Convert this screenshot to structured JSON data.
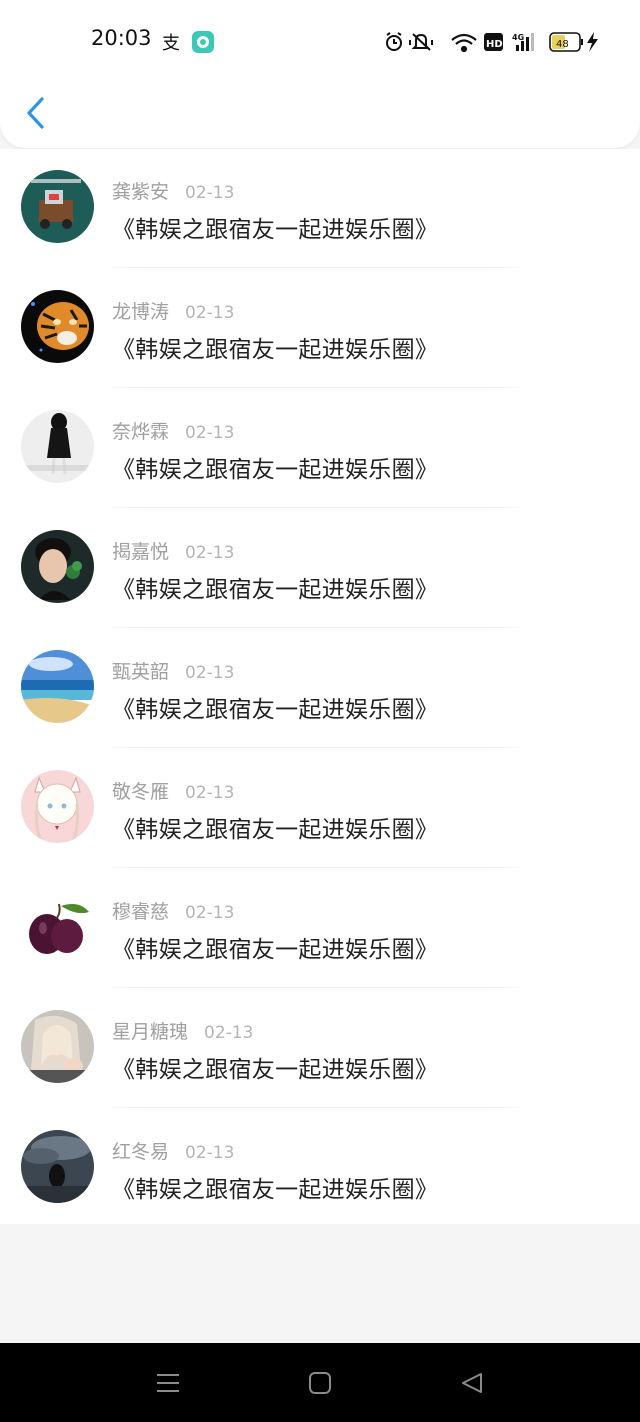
{
  "status_bar": {
    "time": "20:03",
    "battery": "48"
  },
  "header": {
    "back_icon": "chevron-left-icon",
    "accent_color": "#2c96e0"
  },
  "messages": [
    {
      "user": "龚紫安",
      "date": "02-13",
      "text": "《韩娱之跟宿友一起进娱乐圈》"
    },
    {
      "user": "龙博涛",
      "date": "02-13",
      "text": "《韩娱之跟宿友一起进娱乐圈》"
    },
    {
      "user": "奈烨霖",
      "date": "02-13",
      "text": "《韩娱之跟宿友一起进娱乐圈》"
    },
    {
      "user": "揭嘉悦",
      "date": "02-13",
      "text": "《韩娱之跟宿友一起进娱乐圈》"
    },
    {
      "user": "甄英韶",
      "date": "02-13",
      "text": "《韩娱之跟宿友一起进娱乐圈》"
    },
    {
      "user": "敬冬雁",
      "date": "02-13",
      "text": "《韩娱之跟宿友一起进娱乐圈》"
    },
    {
      "user": "穆睿慈",
      "date": "02-13",
      "text": "《韩娱之跟宿友一起进娱乐圈》"
    },
    {
      "user": "星月糖瑰",
      "date": "02-13",
      "text": "《韩娱之跟宿友一起进娱乐圈》"
    },
    {
      "user": "红冬易",
      "date": "02-13",
      "text": "《韩娱之跟宿友一起进娱乐圈》"
    }
  ],
  "avatar_images": [
    "machine-avatar",
    "tiger-avatar",
    "girl-sketch-avatar",
    "young-man-avatar",
    "beach-avatar",
    "anime-cat-girl-avatar",
    "plum-avatar",
    "selfie-girl-avatar",
    "dark-sky-avatar"
  ],
  "nav": {
    "menu_icon": "menu-icon",
    "home_icon": "home-square-icon",
    "back_icon": "back-triangle-icon"
  }
}
